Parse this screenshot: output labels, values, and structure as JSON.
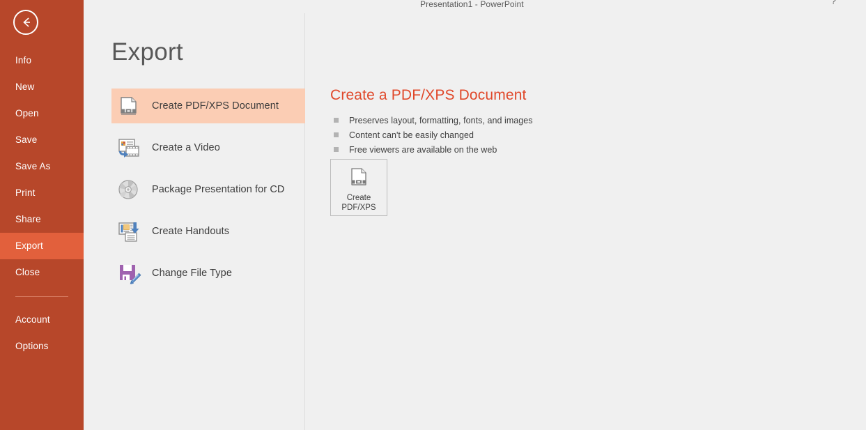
{
  "window": {
    "title": "Presentation1 - PowerPoint",
    "help_icon": "?",
    "minimize_icon": "minimize",
    "accent_color": "#b7472a",
    "active_nav_color": "#e2603c",
    "selected_row_color": "#fbcdb4",
    "heading_color": "#e0482a"
  },
  "sidebar": {
    "back_icon": "back-arrow-icon",
    "items": [
      {
        "label": "Info",
        "active": false
      },
      {
        "label": "New",
        "active": false
      },
      {
        "label": "Open",
        "active": false
      },
      {
        "label": "Save",
        "active": false
      },
      {
        "label": "Save As",
        "active": false
      },
      {
        "label": "Print",
        "active": false
      },
      {
        "label": "Share",
        "active": false
      },
      {
        "label": "Export",
        "active": true
      },
      {
        "label": "Close",
        "active": false
      }
    ],
    "footer_items": [
      {
        "label": "Account"
      },
      {
        "label": "Options"
      }
    ]
  },
  "page": {
    "title": "Export"
  },
  "export_options": [
    {
      "label": "Create PDF/XPS Document",
      "icon": "pdf-document-icon",
      "selected": true
    },
    {
      "label": "Create a Video",
      "icon": "video-icon",
      "selected": false
    },
    {
      "label": "Package Presentation for CD",
      "icon": "cd-disc-icon",
      "selected": false
    },
    {
      "label": "Create Handouts",
      "icon": "handouts-icon",
      "selected": false
    },
    {
      "label": "Change File Type",
      "icon": "floppy-pencil-icon",
      "selected": false
    }
  ],
  "detail": {
    "title": "Create a PDF/XPS Document",
    "bullets": [
      "Preserves layout, formatting, fonts, and images",
      "Content can't be easily changed",
      "Free viewers are available on the web"
    ],
    "button": {
      "icon": "pdf-document-icon",
      "line1": "Create",
      "line2": "PDF/XPS"
    }
  }
}
